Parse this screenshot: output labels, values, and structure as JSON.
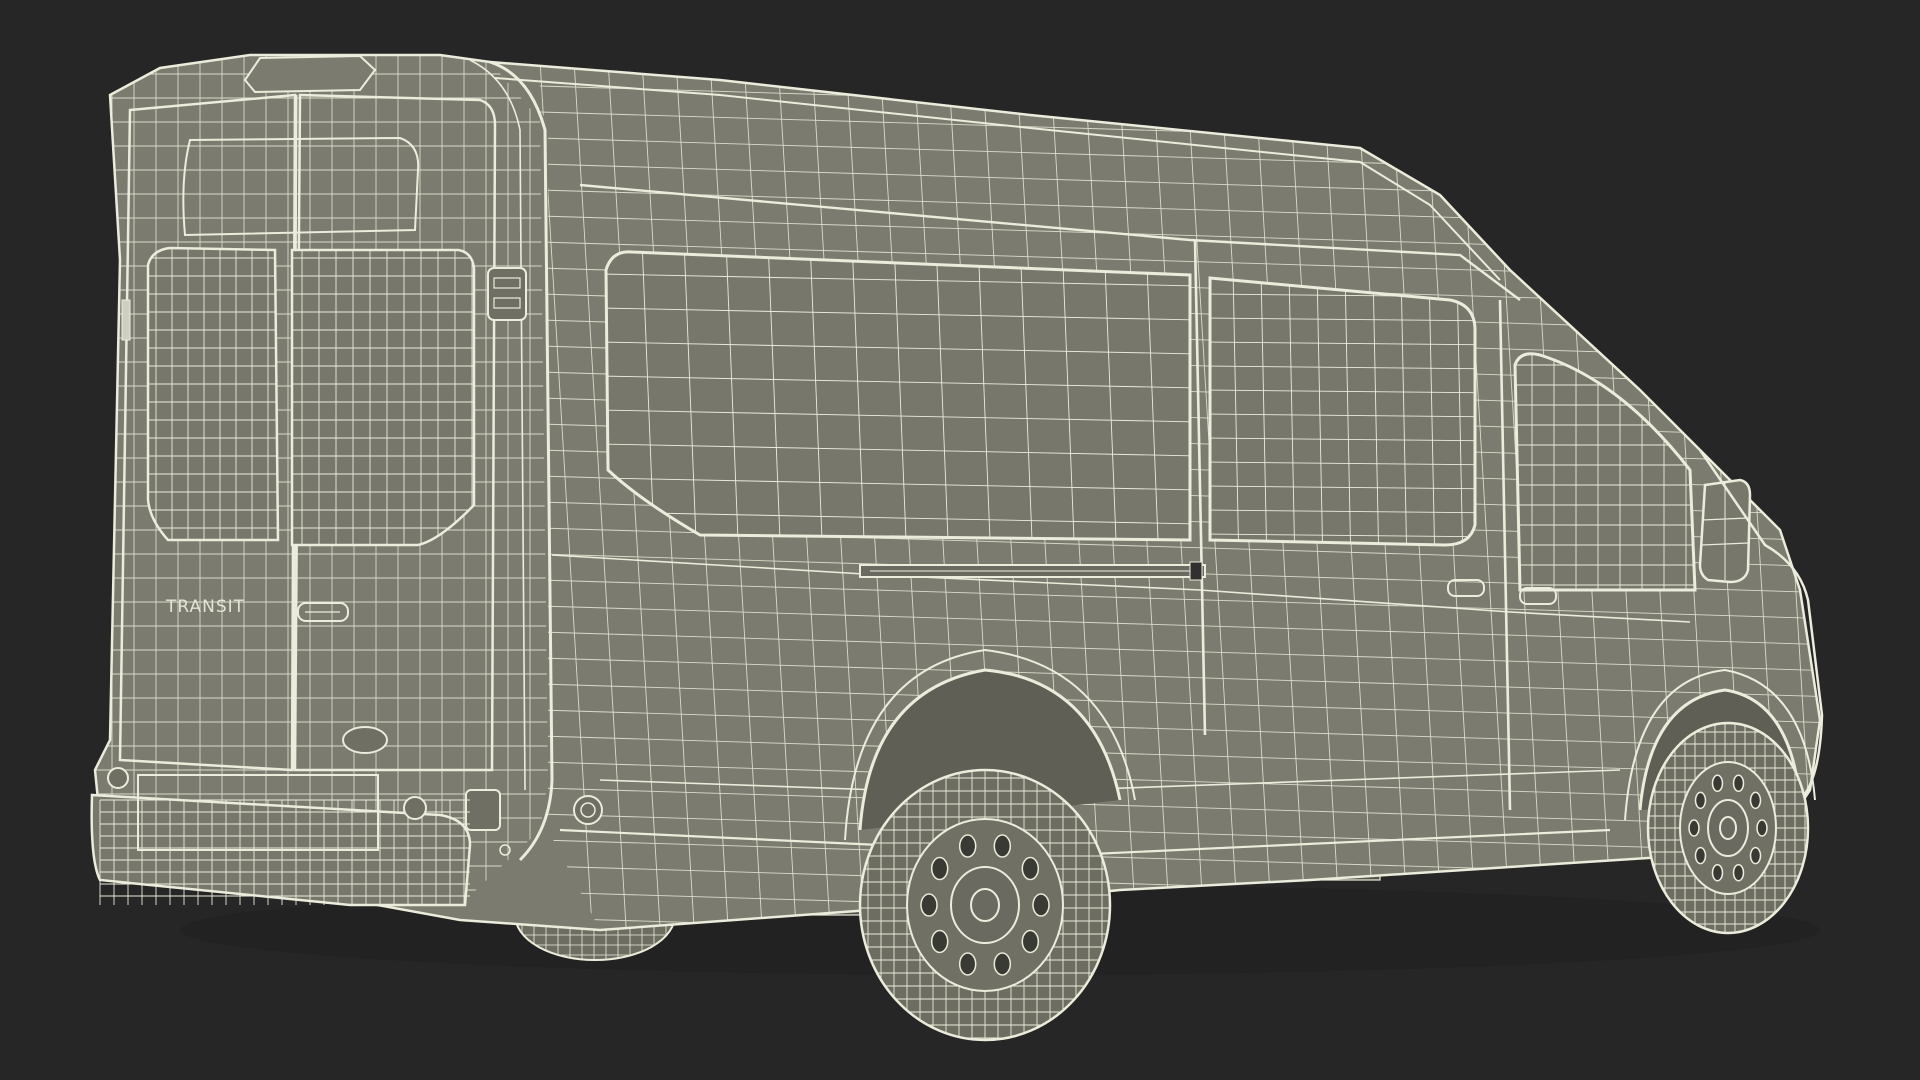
{
  "scene": {
    "background_color": "#262626",
    "surface_color": "#7b7b6f",
    "wire_color": "#ececdc",
    "shadow_color": "#1c1c1c"
  },
  "vehicle": {
    "rear_badge": "TRANSIT"
  }
}
